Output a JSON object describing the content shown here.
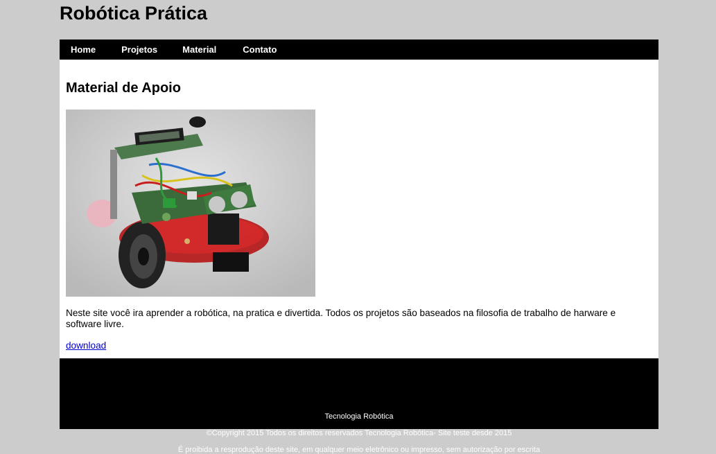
{
  "site": {
    "title": "Robótica Prática"
  },
  "nav": {
    "items": [
      {
        "label": "Home"
      },
      {
        "label": "Projetos"
      },
      {
        "label": "Material"
      },
      {
        "label": "Contato"
      }
    ]
  },
  "main": {
    "heading": "Material de Apoio",
    "intro": "Neste site você ira aprender a robótica, na pratica e divertida. Todos os projetos são baseados na filosofia de trabalho de harware e software livre.",
    "download_link": "download"
  },
  "footer": {
    "line1": "Tecnologia Robótica",
    "line2": "©Copyright 2015 Todos os direitos reservados Tecnologia Robótica- Site teste desde 2015",
    "line3": "É proibida a resprodução deste site, em qualquer meio eletrônico ou impresso, sem autorização por escrita"
  }
}
